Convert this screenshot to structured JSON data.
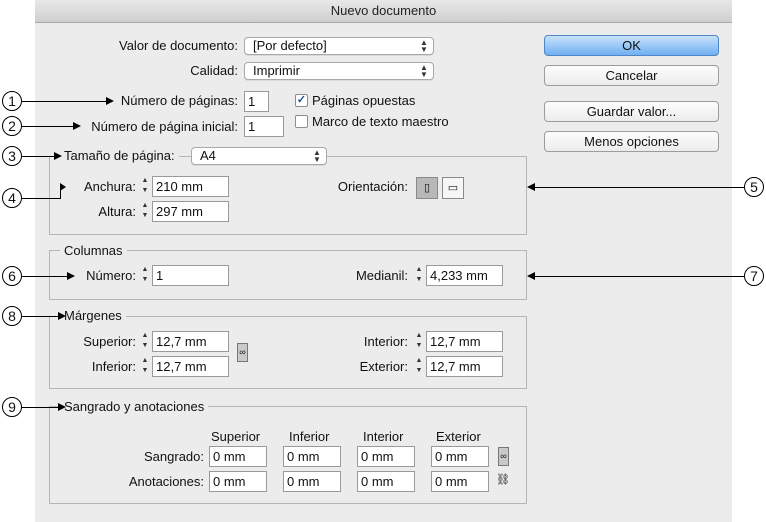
{
  "window": {
    "title": "Nuevo documento"
  },
  "top": {
    "preset_label": "Valor de documento:",
    "preset_value": "[Por defecto]",
    "quality_label": "Calidad:",
    "quality_value": "Imprimir",
    "pages_label": "Número de páginas:",
    "pages_value": "1",
    "start_label": "Número de página inicial:",
    "start_value": "1",
    "facing_label": "Páginas opuestas",
    "facing_checked": true,
    "master_label": "Marco de texto maestro",
    "master_checked": false
  },
  "buttons": {
    "ok": "OK",
    "cancel": "Cancelar",
    "save": "Guardar valor...",
    "fewer": "Menos opciones"
  },
  "page_size": {
    "label": "Tamaño de página:",
    "value": "A4",
    "width_label": "Anchura:",
    "width_value": "210 mm",
    "height_label": "Altura:",
    "height_value": "297 mm",
    "orientation_label": "Orientación:"
  },
  "columns": {
    "title": "Columnas",
    "number_label": "Número:",
    "number_value": "1",
    "gutter_label": "Medianil:",
    "gutter_value": "4,233 mm"
  },
  "margins": {
    "title": "Márgenes",
    "top_label": "Superior:",
    "top_value": "12,7 mm",
    "bottom_label": "Inferior:",
    "bottom_value": "12,7 mm",
    "inside_label": "Interior:",
    "inside_value": "12,7 mm",
    "outside_label": "Exterior:",
    "outside_value": "12,7 mm"
  },
  "bleed": {
    "title": "Sangrado y anotaciones",
    "col_top": "Superior",
    "col_bottom": "Inferior",
    "col_inside": "Interior",
    "col_outside": "Exterior",
    "bleed_label": "Sangrado:",
    "slug_label": "Anotaciones:",
    "bleed_values": [
      "0 mm",
      "0 mm",
      "0 mm",
      "0 mm"
    ],
    "slug_values": [
      "0 mm",
      "0 mm",
      "0 mm",
      "0 mm"
    ]
  },
  "callouts": [
    "1",
    "2",
    "3",
    "4",
    "5",
    "6",
    "7",
    "8",
    "9"
  ]
}
